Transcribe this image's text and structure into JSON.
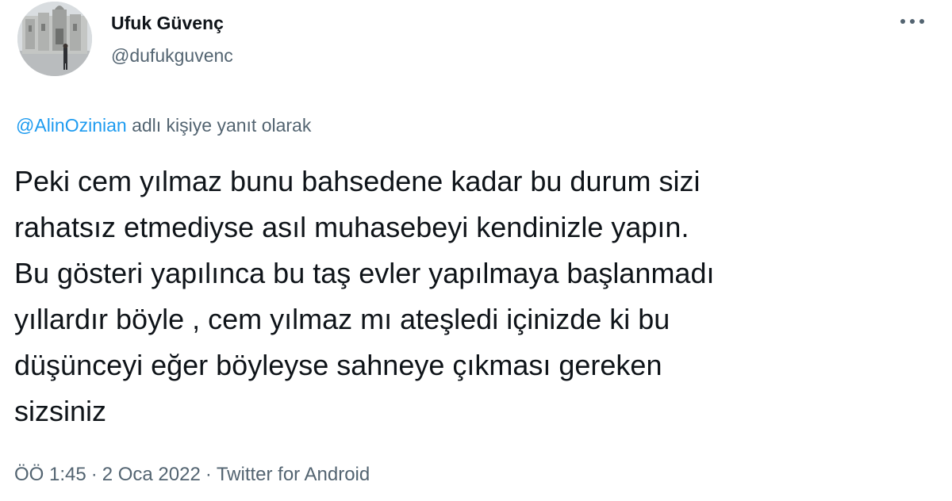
{
  "user": {
    "display_name": "Ufuk Güvenç",
    "handle": "@dufukguvenc"
  },
  "more_icon": "more-horizontal-icon",
  "reply": {
    "mention": "@AlinOzinian",
    "suffix": "adlı kişiye yanıt olarak"
  },
  "tweet": {
    "text": "Peki cem yılmaz bunu bahsedene kadar bu durum sizi\nrahatsız etmediyse asıl muhasebeyi kendinizle yapın.\nBu gösteri yapılınca bu taş evler yapılmaya başlanmadı\nyıllardır böyle , cem yılmaz mı ateşledi içinizde ki bu\ndüşünceyi eğer böyleyse sahneye çıkması gereken\nsizsiniz"
  },
  "meta": {
    "time": "ÖÖ 1:45",
    "separator": "·",
    "date": "2 Oca 2022",
    "source": "Twitter for Android"
  },
  "colors": {
    "text": "#0f1419",
    "secondary": "#536471",
    "link": "#1d9bf0"
  }
}
